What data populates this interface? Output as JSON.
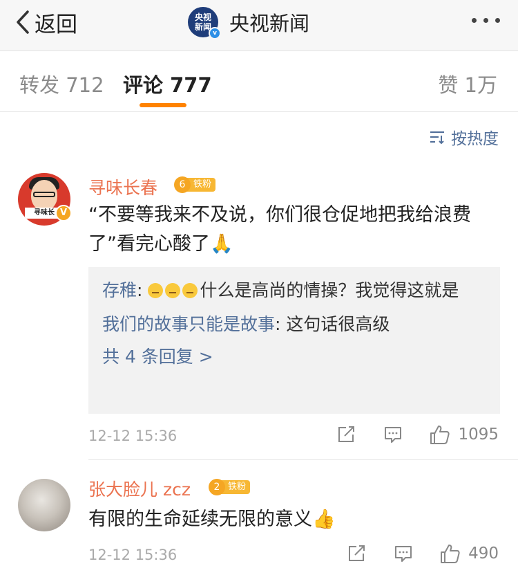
{
  "navbar": {
    "back_label": "返回",
    "account_avatar_text": "央视\n新闻",
    "account_name": "央视新闻",
    "verified_mark": "v"
  },
  "tabs": {
    "repost": "转发 712",
    "comment": "评论 777",
    "like": "赞 1万",
    "active": "评论"
  },
  "sort": {
    "label": "按热度"
  },
  "accent_color": "#ff8200",
  "link_color": "#53709a",
  "name_color": "#eb7350",
  "comments": [
    {
      "name": "寻味长春",
      "avatar_text": "寻味长",
      "verified_mark": "V",
      "fan_level": "6",
      "fan_badge": "铁粉",
      "text": "“不要等我来不及说，你们很仓促地把我给浪费了”看完心酸了",
      "text_emoji": "🙏",
      "replies": [
        {
          "name": "存稚",
          "sep": ": ",
          "text": "什么是高尚的情操？我觉得这就是",
          "emoji_count": 3
        },
        {
          "name": "我们的故事只能是故事",
          "sep": ": ",
          "text": "这句话很高级"
        }
      ],
      "more_replies": "共 4 条回复 >",
      "time": "12-12 15:36",
      "likes": "1095"
    },
    {
      "name": "张大脸儿 zcz",
      "fan_level": "2",
      "fan_badge": "铁粉",
      "text": "有限的生命延续无限的意义",
      "text_emoji": "👍",
      "time": "12-12 15:36",
      "likes": "490"
    }
  ]
}
